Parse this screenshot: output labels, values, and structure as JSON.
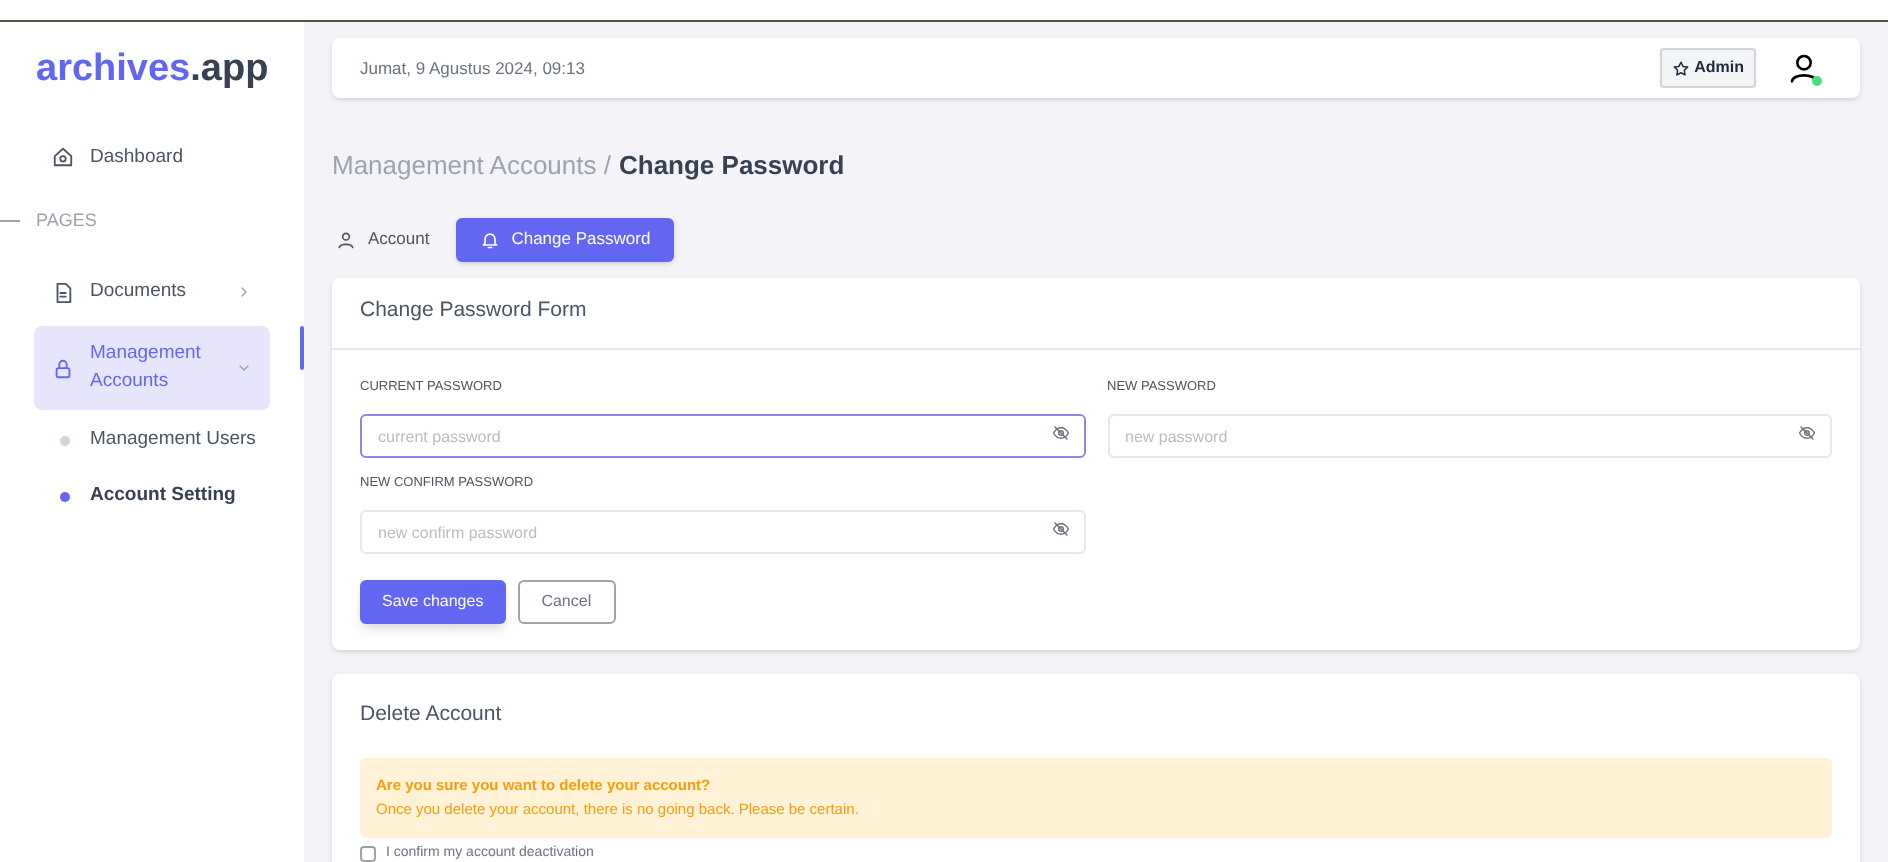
{
  "brand": {
    "name": "archives",
    "suffix": ".app"
  },
  "sidebar": {
    "items": [
      {
        "kind": "link",
        "label": "Dashboard",
        "selected": false
      },
      {
        "kind": "section",
        "label": "PAGES"
      },
      {
        "kind": "link",
        "label": "Documents",
        "selected": false,
        "expanded": false
      },
      {
        "kind": "link",
        "label": "Management Accounts",
        "selected": true,
        "expanded": true,
        "children": [
          {
            "label": "Management Users",
            "selected": false
          },
          {
            "label": "Account Setting",
            "selected": true
          }
        ]
      }
    ]
  },
  "header": {
    "datetime": "Jumat, 9 Agustus 2024, 09:13",
    "role_badge": "Admin",
    "online": true
  },
  "breadcrumb": {
    "parent": "Management Accounts /",
    "current": "Change Password"
  },
  "tabs": [
    {
      "label": "Account",
      "selected": false
    },
    {
      "label": "Change Password",
      "selected": true
    }
  ],
  "form": {
    "title": "Change Password Form",
    "fields": [
      {
        "label": "CURRENT PASSWORD",
        "placeholder": "current password",
        "focused": true
      },
      {
        "label": "NEW PASSWORD",
        "placeholder": "new password",
        "focused": false
      },
      {
        "label": "NEW CONFIRM PASSWORD",
        "placeholder": "new confirm password",
        "focused": false
      }
    ],
    "buttons": [
      {
        "label": "Save changes",
        "kind": "primary"
      },
      {
        "label": "Cancel",
        "kind": "secondary"
      }
    ]
  },
  "delete_account": {
    "title": "Delete Account",
    "warning_title": "Are you sure you want to delete your account?",
    "warning_text": "Once you delete your account, there is no going back. Please be certain.",
    "confirm_label": "I confirm my account deactivation",
    "confirm_checked": false
  }
}
